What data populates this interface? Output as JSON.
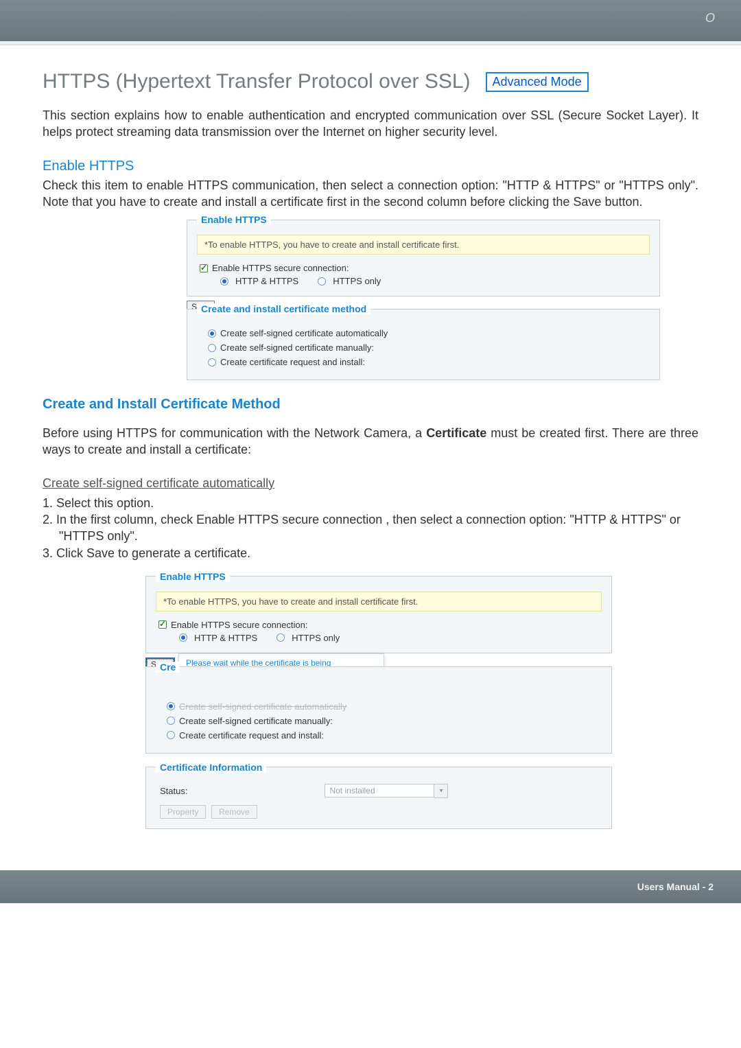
{
  "header": {
    "corner": "O"
  },
  "title": "HTTPS (Hypertext Transfer Protocol over SSL)",
  "adv_mode": "Advanced Mode",
  "intro": "This section explains how to enable authentication and encrypted communication over SSL (Secure Socket Layer). It helps protect streaming data transmission over the Internet on higher security level.",
  "enable_https": {
    "heading": "Enable HTTPS",
    "paragraph": "Check this item to enable HTTPS communication, then select a connection option: \"HTTP & HTTPS\" or \"HTTPS only\". Note that you have to create and install a certificate first in the second column before clicking the Save button.",
    "fieldset1": {
      "legend": "Enable HTTPS",
      "note": "*To enable HTTPS, you have to create and install certificate first.",
      "checkbox": "Enable HTTPS secure connection:",
      "opt1": "HTTP & HTTPS",
      "opt2": "HTTPS only"
    },
    "save": "Save",
    "fieldset2": {
      "legend": "Create and install certificate method",
      "r1": "Create self-signed certificate automatically",
      "r2": "Create self-signed certificate manually:",
      "r3": "Create certificate request and install:"
    }
  },
  "method": {
    "heading": "Create and Install Certificate Method",
    "paragraph_a": "Before using HTTPS for communication with the Network Camera, a ",
    "paragraph_bold": "Certificate",
    "paragraph_b": " must be created first. There are three ways to create and install a certificate:",
    "auto_head": "Create self-signed certificate automatically",
    "steps": [
      "1. Select this option.",
      "2. In the first column, check Enable HTTPS secure connection   , then select a connection option: \"HTTP & HTTPS\" or \"HTTPS only\".",
      "3. Click Save to generate a certificate."
    ]
  },
  "ui2": {
    "legend": "Enable HTTPS",
    "note": "*To enable HTTPS, you have to create and install certificate first.",
    "checkbox": "Enable HTTPS secure connection:",
    "opt1": "HTTP & HTTPS",
    "opt2": "HTTPS only",
    "save": "Save",
    "cr_prefix": "Cre",
    "popup": "Please wait while the certificate is being generated...",
    "r1": "Create self-signed certificate automatically",
    "r2": "Create self-signed certificate manually:",
    "r3": "Create certificate request and install:",
    "cert_legend": "Certificate Information",
    "status_label": "Status:",
    "status_value": "Not installed",
    "btn_property": "Property",
    "btn_remove": "Remove"
  },
  "footer": {
    "label": "Users Manual - 2"
  }
}
